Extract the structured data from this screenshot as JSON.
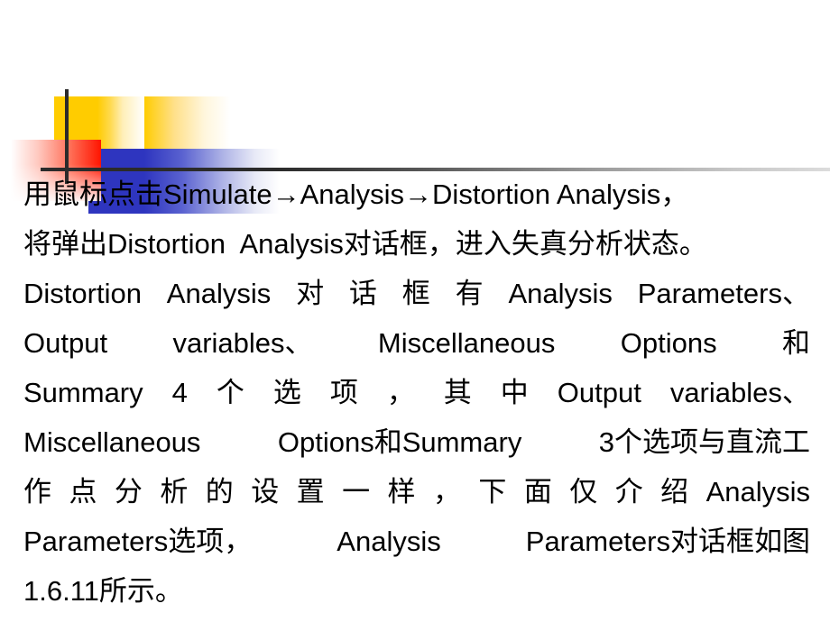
{
  "slide": {
    "background_color": "#ffffff",
    "decoration": {
      "name": "corner-motif",
      "yellow_color": "#FFCC00",
      "blue_color": "#2E35BF",
      "red_color": "#FF1400",
      "rule_color": "#2B2B2B"
    },
    "paragraph": {
      "full_text": "用鼠标点击Simulate→Analysis→Distortion Analysis，将弹出Distortion Analysis对话框，进入失真分析状态。Distortion Analysis对话框有Analysis Parameters、Output variables、Miscellaneous Options 和Summary 4个选项，其中Output variables、Miscellaneous Options和Summary 3个选项与直流工作点分析的设置一样，下面仅介绍Analysis Parameters选项，Analysis Parameters对话框如图1.6.11所示。",
      "lines": [
        {
          "justified": false,
          "tokens": [
            "用鼠标点击Simulate→Analysis→Distortion Analysis，"
          ]
        },
        {
          "justified": false,
          "tokens": [
            "将弹出Distortion  Analysis对话框，进入失真分析状态。"
          ]
        },
        {
          "justified": true,
          "tokens": [
            "Distortion",
            "Analysis",
            "对",
            "话",
            "框",
            "有",
            "Analysis",
            "Parameters、"
          ]
        },
        {
          "justified": true,
          "tokens": [
            "Output",
            "variables、",
            "Miscellaneous",
            "Options",
            "和"
          ]
        },
        {
          "justified": true,
          "tokens": [
            "Summary",
            "4",
            "个",
            "选",
            "项",
            "，",
            "其",
            "中",
            "Output",
            "variables、"
          ]
        },
        {
          "justified": true,
          "tokens": [
            "Miscellaneous",
            "Options和Summary",
            "3个选项与直流工"
          ]
        },
        {
          "justified": true,
          "tokens": [
            "作",
            "点",
            "分",
            "析",
            "的",
            "设",
            "置",
            "一",
            "样",
            "，",
            "下",
            "面",
            "仅",
            "介",
            "绍",
            "Analysis"
          ]
        },
        {
          "justified": true,
          "tokens": [
            "Parameters选项，",
            "Analysis",
            "Parameters对话框如图"
          ]
        },
        {
          "justified": false,
          "tokens": [
            "1.6.11所示。"
          ]
        }
      ]
    }
  }
}
